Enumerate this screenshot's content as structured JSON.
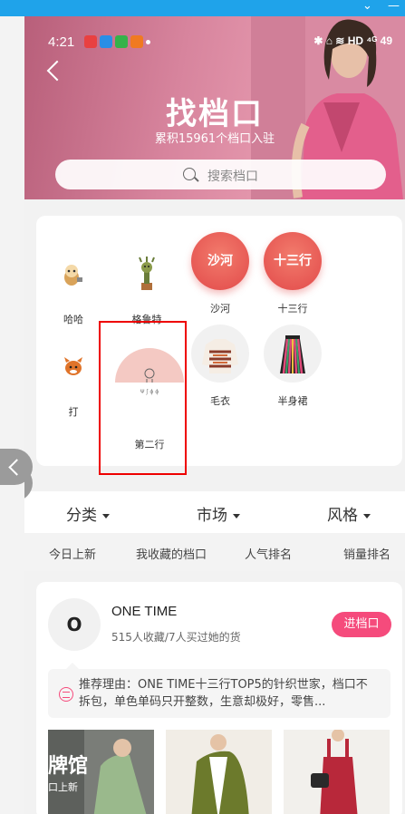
{
  "status_bar": {
    "time": "4:21",
    "right": "✱ ⌂ ≋ HD ⁴ᴳ 49"
  },
  "header": {
    "title": "找档口",
    "subtitle": "累积15961个档口入驻",
    "search_placeholder": "搜索档口"
  },
  "grid": [
    {
      "label": "哈哈"
    },
    {
      "label": "格鲁特"
    },
    {
      "label": "沙河",
      "badge": "沙河"
    },
    {
      "label": "十三行",
      "badge": "十三行"
    },
    {
      "label": "打"
    },
    {
      "label": "第二行",
      "mini": "Ψ ʃ ɸ ɸ"
    },
    {
      "label": "毛衣"
    },
    {
      "label": "半身裙"
    }
  ],
  "filters": [
    {
      "label": "分类"
    },
    {
      "label": "市场"
    },
    {
      "label": "风格"
    }
  ],
  "tabs": [
    {
      "label": "今日上新"
    },
    {
      "label": "我收藏的档口"
    },
    {
      "label": "人气排名"
    },
    {
      "label": "销量排名"
    }
  ],
  "shop": {
    "logo": "O",
    "name": "ONE TIME",
    "stats": "515人收藏/7人买过她的货",
    "enter_label": "进档口",
    "reason": "推荐理由：ONE TIME十三行TOP5的针织世家，档口不拆包，单色单码只开整数，生意却极好，零售...",
    "photo_overlay": "牌馆",
    "photo_overlay_sub": "口上新"
  },
  "colors": {
    "accent": "#f54b7c",
    "topbar": "#1fa3ea",
    "badge_red": "#e24a4a"
  }
}
